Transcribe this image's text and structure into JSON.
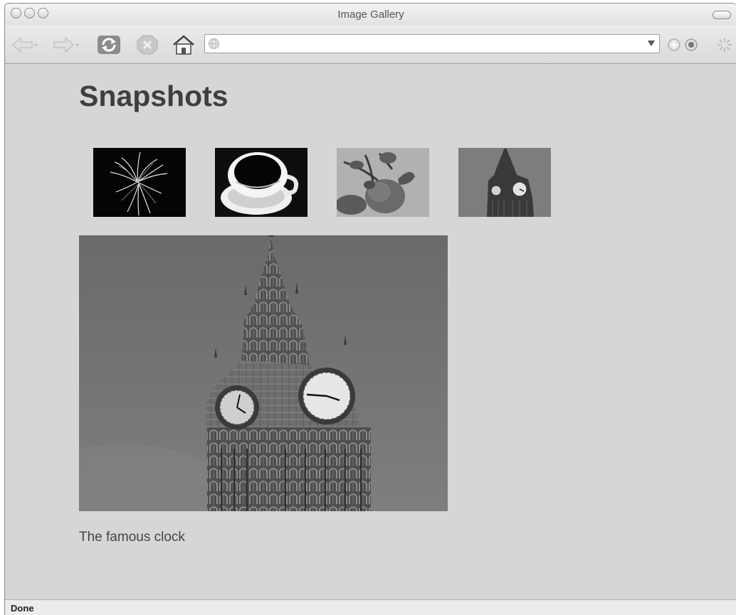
{
  "window": {
    "title": "Image Gallery"
  },
  "toolbar": {
    "icons": [
      "back-arrow-icon",
      "forward-arrow-icon",
      "reload-icon",
      "stop-icon",
      "home-icon",
      "add-bookmark-icon",
      "downloads-icon",
      "activity-spinner-icon"
    ],
    "url": {
      "value": ""
    }
  },
  "page": {
    "heading": "Snapshots",
    "thumbnails": [
      {
        "subject": "fireworks"
      },
      {
        "subject": "coffee cup"
      },
      {
        "subject": "rose"
      },
      {
        "subject": "clock tower"
      }
    ],
    "caption": "The famous clock"
  },
  "statusbar": {
    "text": "Done"
  },
  "colors": {
    "page_bg": "#d6d6d6",
    "heading": "#3f3f3f",
    "window_chrome": "#e4e4e4"
  }
}
